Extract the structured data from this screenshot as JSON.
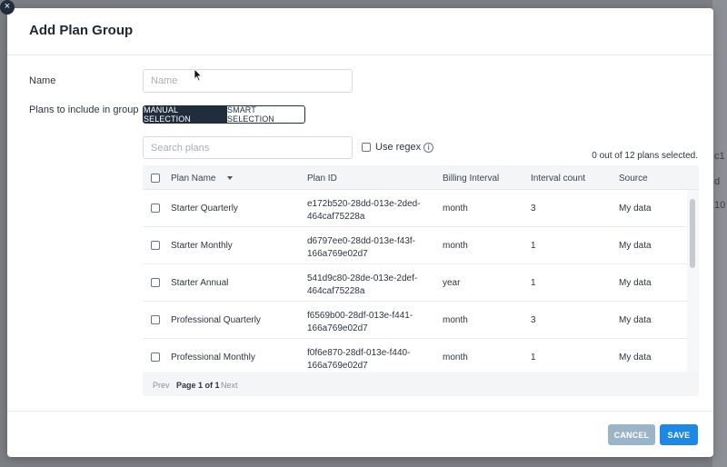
{
  "modal": {
    "title": "Add Plan Group",
    "close_glyph": "×",
    "name_label": "Name",
    "name_placeholder": "Name",
    "name_value": "",
    "plans_label": "Plans to include in group",
    "selection_modes": [
      "MANUAL SELECTION",
      "SMART SELECTION"
    ],
    "selected_mode": "MANUAL SELECTION",
    "search_placeholder": "Search plans",
    "regex_label": "Use regex",
    "info_glyph": "i",
    "selection_count": "0 out of 12 plans selected."
  },
  "table": {
    "columns": [
      "Plan Name",
      "Plan ID",
      "Billing Interval",
      "Interval count",
      "Source"
    ],
    "rows": [
      {
        "name": "Starter Quarterly",
        "id_line1": "e172b520-28dd-013e-2ded-",
        "id_line2": "464caf75228a",
        "billing": "month",
        "interval": "3",
        "source": "My data"
      },
      {
        "name": "Starter Monthly",
        "id_line1": "d6797ee0-28dd-013e-f43f-",
        "id_line2": "166a769e02d7",
        "billing": "month",
        "interval": "1",
        "source": "My data"
      },
      {
        "name": "Starter Annual",
        "id_line1": "541d9c80-28de-013e-2def-",
        "id_line2": "464caf75228a",
        "billing": "year",
        "interval": "1",
        "source": "My data"
      },
      {
        "name": "Professional Quarterly",
        "id_line1": "f6569b00-28df-013e-f441-",
        "id_line2": "166a769e02d7",
        "billing": "month",
        "interval": "3",
        "source": "My data"
      },
      {
        "name": "Professional Monthly",
        "id_line1": "f0f6e870-28df-013e-f440-",
        "id_line2": "166a769e02d7",
        "billing": "month",
        "interval": "1",
        "source": "My data"
      }
    ],
    "pager": {
      "prev": "Prev",
      "page": "Page 1 of 1",
      "next": "Next"
    }
  },
  "footer": {
    "cancel": "CANCEL",
    "save": "SAVE"
  },
  "colors": {
    "primary": "#1e88e5",
    "cancel": "#9bb4c7",
    "dark": "#1f2d3d"
  },
  "icons": [
    "close-icon",
    "info-icon",
    "sort-down-icon",
    "checkbox-icon",
    "mouse-pointer-icon"
  ],
  "background_fragments": [
    "c1",
    "d",
    "10"
  ]
}
